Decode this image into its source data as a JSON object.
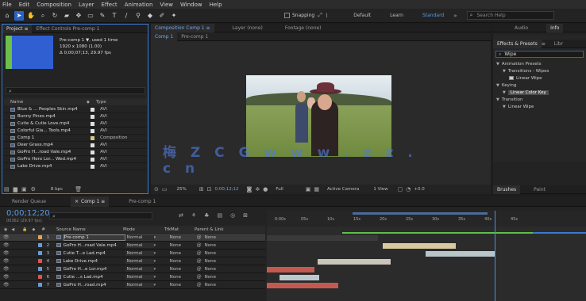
{
  "menu": [
    "File",
    "Edit",
    "Composition",
    "Layer",
    "Effect",
    "Animation",
    "View",
    "Window",
    "Help"
  ],
  "toolbar": {
    "snapping": "Snapping",
    "workspaces": [
      "Default",
      "Learn",
      "Standard"
    ],
    "search_placeholder": "Search Help"
  },
  "project": {
    "tabs": [
      "Project",
      "Effect Controls Pre-comp 1"
    ],
    "info": [
      "Pre-comp 1 ▼, used 1 time",
      "1920 x 1080 (1.00)",
      "Δ 0;00;07;13, 29.97 fps"
    ],
    "columns": [
      "Name",
      "Type"
    ],
    "items": [
      {
        "name": "Blue & ... Peoples Skin.mp4",
        "type": "AVI",
        "color": "#e0e0e0"
      },
      {
        "name": "Bunny Pines.mp4",
        "type": "AVI",
        "color": "#e0e0e0"
      },
      {
        "name": "Cutie & Cutie Love.mp4",
        "type": "AVI",
        "color": "#e0e0e0"
      },
      {
        "name": "Colorful Gla... Tools.mp4",
        "type": "AVI",
        "color": "#e0e0e0"
      },
      {
        "name": "Comp 1",
        "type": "Composition",
        "color": "#d9c58a"
      },
      {
        "name": "Deer Grass.mp4",
        "type": "AVI",
        "color": "#e0e0e0"
      },
      {
        "name": "GoPro H...road Vale.mp4",
        "type": "AVI",
        "color": "#e0e0e0"
      },
      {
        "name": "GoPro Hero Lor... Wed.mp4",
        "type": "AVI",
        "color": "#e0e0e0"
      },
      {
        "name": "Lake Drive.mp4",
        "type": "AVI",
        "color": "#e0e0e0"
      }
    ],
    "bpc": "8 bpc"
  },
  "comp": {
    "tabs": [
      "Composition Comp 1",
      "Layer (none)",
      "Footage (none)"
    ],
    "subtabs": [
      "Comp 1",
      "Pre-comp 1"
    ],
    "zoom": "25%",
    "time": "0;00;12;12",
    "res": "Full",
    "camera": "Active Camera",
    "view": "1 View",
    "offset": "+0.0"
  },
  "effects": {
    "tabs": [
      "Audio",
      "Info"
    ],
    "title": "Effects & Presets",
    "alt": "Libr",
    "search": "Wipe",
    "tree": [
      {
        "label": "Animation Presets",
        "indent": 0
      },
      {
        "label": "Transitions - Wipes",
        "indent": 1
      },
      {
        "label": "Linear Wipe",
        "indent": 2
      },
      {
        "label": "Keying",
        "indent": 0
      },
      {
        "label": "Linear Color Key",
        "indent": 1,
        "hl": true
      },
      {
        "label": "Transition",
        "indent": 0
      },
      {
        "label": "Linear Wipe",
        "indent": 1
      }
    ]
  },
  "align": {
    "tabs": [
      "Brushes",
      "Paint"
    ]
  },
  "timeline": {
    "tabs": [
      "Render Queue",
      "Comp 1",
      "Pre-comp 1"
    ],
    "timecode": "0;00;12;20",
    "fps": "00362 (29.97 fps)",
    "headers": [
      "#",
      "Source Name",
      "Mode",
      "T",
      "TrkMat",
      "Parent & Link"
    ],
    "ruler": [
      "0:00s",
      "05s",
      "10s",
      "15s",
      "20s",
      "25s",
      "30s",
      "35s",
      "40s",
      "45s"
    ],
    "layers": [
      {
        "n": "1",
        "name": "Pre-comp 1",
        "mode": "Normal",
        "trk": "None",
        "parent": "None",
        "color": "#e0a25e",
        "sel": true
      },
      {
        "n": "2",
        "name": "GoPro H...road Vale.mp4",
        "mode": "Normal",
        "trk": "None",
        "parent": "None",
        "color": "#6a9bd1"
      },
      {
        "n": "3",
        "name": "Cutie T...e Lad.mp4",
        "mode": "Normal",
        "trk": "None",
        "parent": "None",
        "color": "#6a9bd1"
      },
      {
        "n": "4",
        "name": "Lake Drive.mp4",
        "mode": "Normal",
        "trk": "None",
        "parent": "None",
        "color": "#d9574d"
      },
      {
        "n": "5",
        "name": "GoPro H...e Lor.mp4",
        "mode": "Normal",
        "trk": "None",
        "parent": "None",
        "color": "#6a9bd1"
      },
      {
        "n": "6",
        "name": "Cutie ...s Lad.mp4",
        "mode": "Normal",
        "trk": "None",
        "parent": "None",
        "color": "#d9574d"
      },
      {
        "n": "7",
        "name": "GoPro H...road.mp4",
        "mode": "Normal",
        "trk": "None",
        "parent": "None",
        "color": "#6a9bd1"
      }
    ]
  },
  "watermark": "梅 Z C G   w w w . z z . c n"
}
